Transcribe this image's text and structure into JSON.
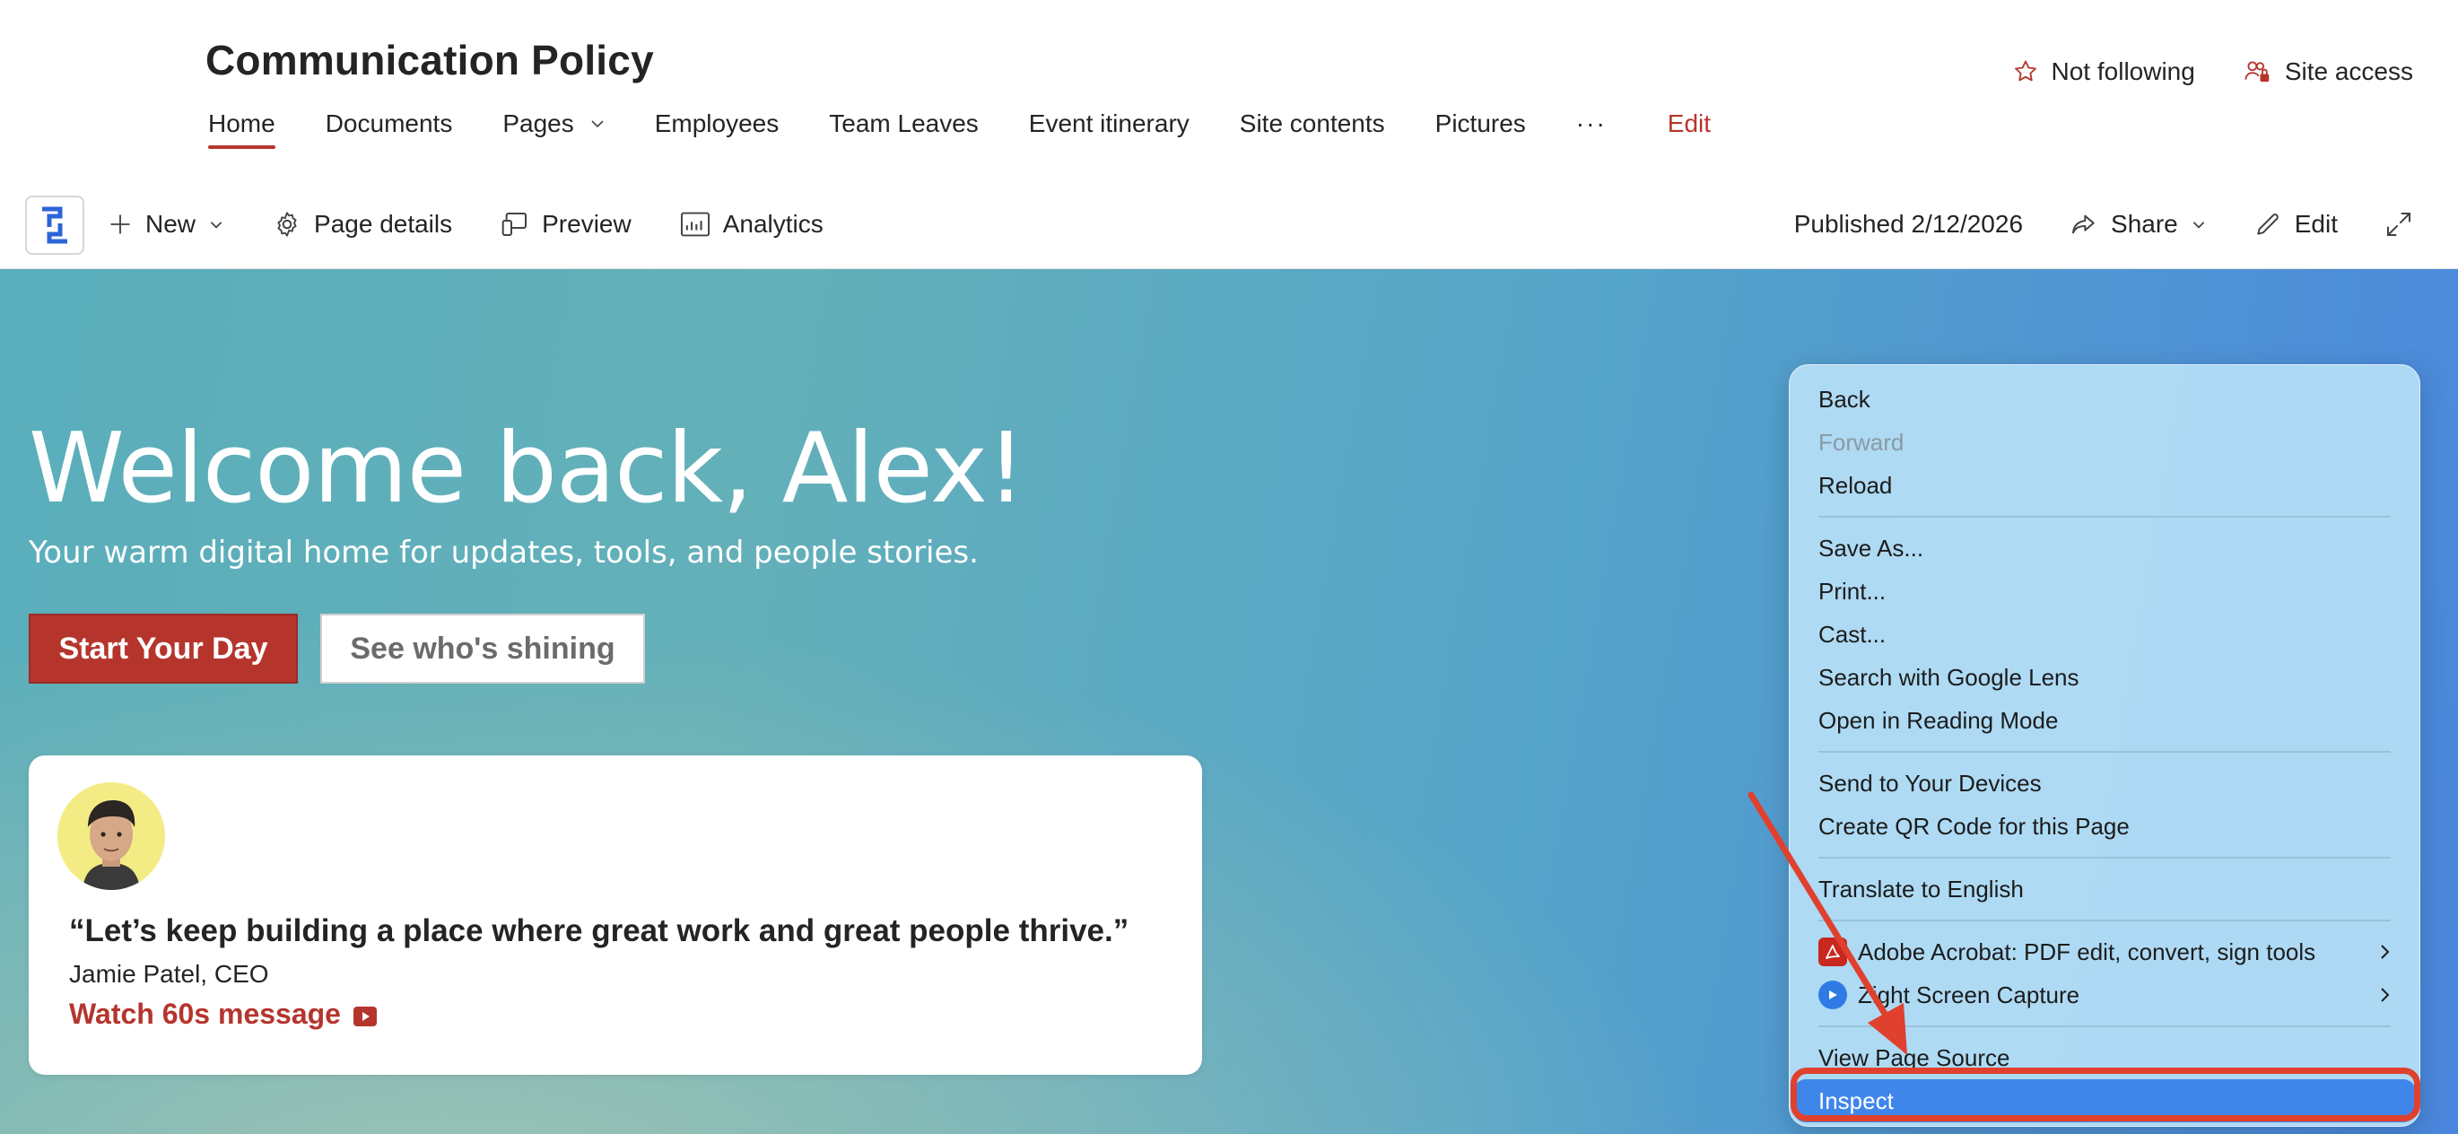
{
  "site": {
    "title": "Communication Policy",
    "nav": [
      {
        "label": "Home"
      },
      {
        "label": "Documents"
      },
      {
        "label": "Pages"
      },
      {
        "label": "Employees"
      },
      {
        "label": "Team Leaves"
      },
      {
        "label": "Event itinerary"
      },
      {
        "label": "Site contents"
      },
      {
        "label": "Pictures"
      },
      {
        "label": "···"
      },
      {
        "label": "Edit"
      }
    ],
    "follow_label": "Not following",
    "site_access_label": "Site access"
  },
  "cmdbar": {
    "new_label": "New",
    "page_details_label": "Page details",
    "preview_label": "Preview",
    "analytics_label": "Analytics",
    "published_label": "Published 2/12/2026",
    "share_label": "Share",
    "edit_label": "Edit"
  },
  "hero": {
    "welcome": "Welcome back, Alex!",
    "tagline": "Your warm digital home for updates, tools, and people stories.",
    "primary_button": "Start Your Day",
    "secondary_button": "See who's shining",
    "quote": "“Let’s keep building a place where great work and great people thrive.”",
    "author": "Jamie Patel, CEO",
    "watch_link": "Watch 60s message"
  },
  "context_menu": {
    "items": [
      {
        "label": "Back"
      },
      {
        "label": "Forward"
      },
      {
        "label": "Reload"
      },
      {
        "label": "Save As..."
      },
      {
        "label": "Print..."
      },
      {
        "label": "Cast..."
      },
      {
        "label": "Search with Google Lens"
      },
      {
        "label": "Open in Reading Mode"
      },
      {
        "label": "Send to Your Devices"
      },
      {
        "label": "Create QR Code for this Page"
      },
      {
        "label": "Translate to English"
      },
      {
        "label": "Adobe Acrobat: PDF edit, convert, sign tools"
      },
      {
        "label": "Zight Screen Capture"
      },
      {
        "label": "View Page Source"
      },
      {
        "label": "Inspect"
      }
    ]
  },
  "colors": {
    "accent": "#b5352d",
    "menu_highlight": "#3f86ea",
    "annotation": "#e0412f"
  }
}
